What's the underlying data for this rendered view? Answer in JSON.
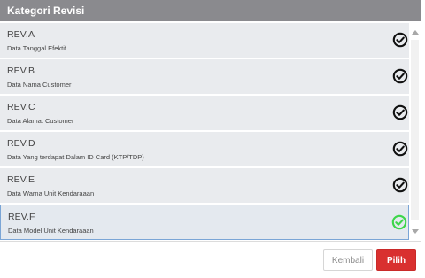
{
  "dialog": {
    "title": "Kategori Revisi"
  },
  "items": [
    {
      "code": "REV.A",
      "desc": "Data Tanggal Efektif",
      "icon": "check-circle-icon",
      "checked": true,
      "selected": false
    },
    {
      "code": "REV.B",
      "desc": "Data Nama Customer",
      "icon": "check-circle-icon",
      "checked": true,
      "selected": false
    },
    {
      "code": "REV.C",
      "desc": "Data Alamat Customer",
      "icon": "check-circle-icon",
      "checked": true,
      "selected": false
    },
    {
      "code": "REV.D",
      "desc": "Data Yang terdapat Dalam ID Card (KTP/TDP)",
      "icon": "check-circle-icon",
      "checked": true,
      "selected": false
    },
    {
      "code": "REV.E",
      "desc": "Data Warna Unit Kendaraaan",
      "icon": "check-circle-icon",
      "checked": true,
      "selected": false
    },
    {
      "code": "REV.F",
      "desc": "Data Model Unit Kendaraaan",
      "icon": "check-circle-icon",
      "checked": true,
      "selected": true
    }
  ],
  "buttons": {
    "back_label": "Kembali",
    "choose_label": "Pilih"
  },
  "colors": {
    "header_bg": "#8a8a8e",
    "check_default": "#111111",
    "check_selected": "#3cd64a",
    "primary_button": "#d9302f"
  }
}
